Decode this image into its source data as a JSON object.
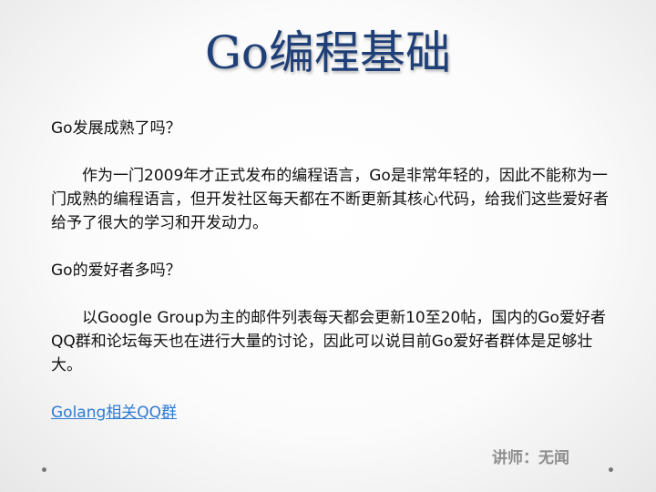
{
  "slide": {
    "title": "Go编程基础",
    "questions": [
      {
        "question": "Go发展成熟了吗？",
        "answer": "作为一门2009年才正式发布的编程语言，Go是非常年轻的，因此不能称为一门成熟的编程语言，但开发社区每天都在不断更新其核心代码，给我们这些爱好者给予了很大的学习和开发动力。"
      },
      {
        "question": "Go的爱好者多吗？",
        "answer": "以Google Group为主的邮件列表每天都会更新10至20帖，国内的Go爱好者QQ群和论坛每天也在进行大量的讨论，因此可以说目前Go爱好者群体是足够壮大。"
      }
    ],
    "link_text": "Golang相关QQ群",
    "footer_text": "讲师：无闻"
  }
}
